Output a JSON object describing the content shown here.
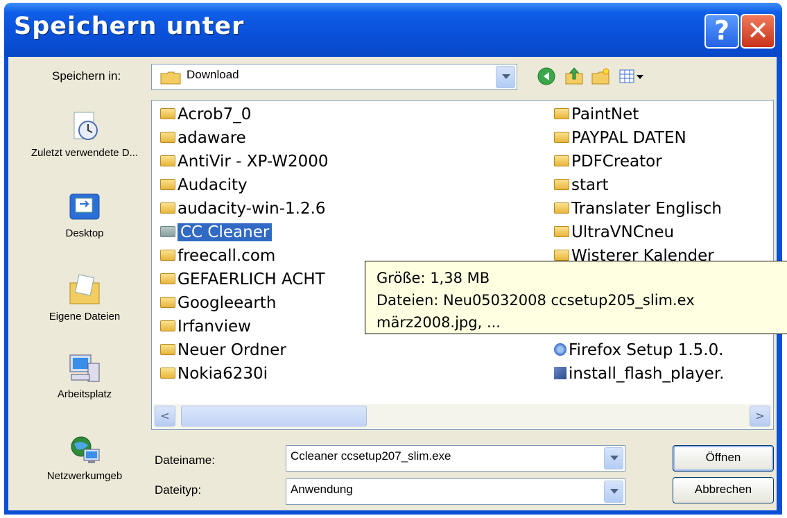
{
  "dialog": {
    "title": "Speichern unter",
    "help_symbol": "?",
    "close_symbol": "✕"
  },
  "toolbar": {
    "save_in_label": "Speichern in:",
    "save_in_value": "Download",
    "icons": [
      "back-icon",
      "up-folder-icon",
      "new-folder-icon",
      "view-menu-icon"
    ]
  },
  "places": [
    {
      "label": "Zuletzt verwendete D...",
      "icon": "recent-documents-icon"
    },
    {
      "label": "Desktop",
      "icon": "desktop-icon"
    },
    {
      "label": "Eigene Dateien",
      "icon": "my-documents-icon"
    },
    {
      "label": "Arbeitsplatz",
      "icon": "my-computer-icon"
    },
    {
      "label": "Netzwerkumgeb",
      "icon": "network-icon"
    }
  ],
  "files": {
    "column1": [
      "Acrob7_0",
      "adaware",
      "AntiVir - XP-W2000",
      "Audacity",
      "audacity-win-1.2.6",
      "CC Cleaner",
      "freecall.com",
      "GEFAERLICH ACHT",
      "Googleearth",
      "Irfanview",
      "Neuer Ordner",
      "Nokia6230i"
    ],
    "column2": [
      "PaintNet",
      "PAYPAL  DATEN",
      "PDFCreator",
      "start",
      "Translater Englisch",
      "UltraVNCneu",
      "Wisterer Kalender",
      "Firefox Setup 1.5.0.",
      "install_flash_player."
    ],
    "selected": "CC Cleaner"
  },
  "tooltip": {
    "line1": "Größe: 1,38 MB",
    "line2": "Dateien: Neu05032008 ccsetup205_slim.ex",
    "line3": "märz2008.jpg, ..."
  },
  "filename": {
    "label": "Dateiname:",
    "value": "Ccleaner ccsetup207_slim.exe"
  },
  "filetype": {
    "label": "Dateityp:",
    "value": "Anwendung"
  },
  "buttons": {
    "open": "Öffnen",
    "cancel": "Abbrechen"
  },
  "scroll": {
    "left_arrow": "<",
    "right_arrow": ">"
  }
}
